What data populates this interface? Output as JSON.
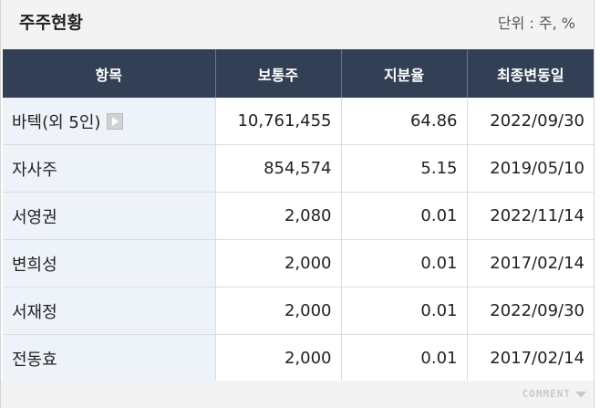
{
  "header": {
    "title": "주주현황",
    "unit": "단위 : 주, %"
  },
  "table": {
    "columns": [
      "항목",
      "보통주",
      "지분율",
      "최종변동일"
    ],
    "rows": [
      {
        "name": "바텍(외 5인)",
        "shares": "10,761,455",
        "ratio": "64.86",
        "date": "2022/09/30",
        "has_more": true
      },
      {
        "name": "자사주",
        "shares": "854,574",
        "ratio": "5.15",
        "date": "2019/05/10"
      },
      {
        "name": "서영권",
        "shares": "2,080",
        "ratio": "0.01",
        "date": "2022/11/14"
      },
      {
        "name": "변희성",
        "shares": "2,000",
        "ratio": "0.01",
        "date": "2017/02/14"
      },
      {
        "name": "서재정",
        "shares": "2,000",
        "ratio": "0.01",
        "date": "2022/09/30"
      },
      {
        "name": "전동효",
        "shares": "2,000",
        "ratio": "0.01",
        "date": "2017/02/14"
      }
    ]
  },
  "footer": {
    "comment_label": "COMMENT",
    "comment_icon": "chevron-down-icon"
  },
  "colors": {
    "header_bg": "#333f55",
    "name_cell_bg": "#eef2f9",
    "panel_bg": "#f3f3f3"
  }
}
